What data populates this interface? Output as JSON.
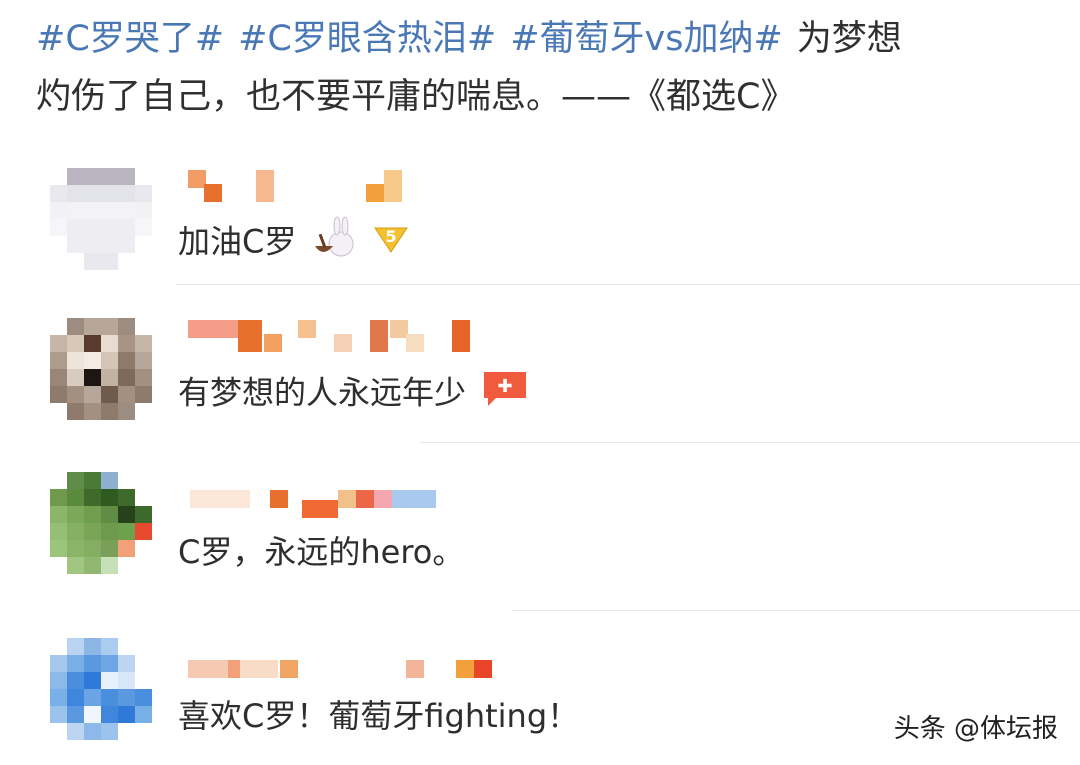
{
  "post": {
    "hashtags": [
      "#C罗哭了#",
      "#C罗眼含热泪#",
      "#葡萄牙vs加纳#"
    ],
    "text_line1": "为梦想",
    "text_line2": "灼伤了自己，也不要平庸的喘息。——《都选C》"
  },
  "comments": [
    {
      "text": "加油C罗",
      "emoji": "rabbit-icon, badge-5-icon"
    },
    {
      "text": "有梦想的人永远年少",
      "emoji": "jiayou-sticker-icon"
    },
    {
      "text": "C罗，永远的hero。",
      "emoji": ""
    },
    {
      "text": "喜欢C罗！葡萄牙fighting！",
      "emoji": ""
    }
  ],
  "watermark": "头条 @体坛报",
  "colors": {
    "hashtag": "#4a78b5",
    "text": "#2e2e2e",
    "divider": "#e6e6e6"
  }
}
